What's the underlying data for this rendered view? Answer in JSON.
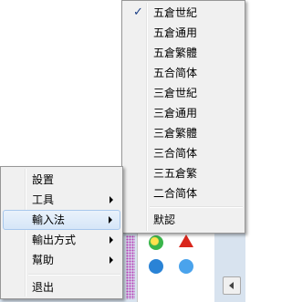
{
  "main_menu": {
    "items": [
      {
        "label": "設置",
        "has_submenu": false
      },
      {
        "label": "工具",
        "has_submenu": true
      },
      {
        "label": "輸入法",
        "has_submenu": true,
        "highlighted": true
      },
      {
        "label": "輸出方式",
        "has_submenu": true
      },
      {
        "label": "幫助",
        "has_submenu": true
      },
      {
        "label": "退出",
        "has_submenu": false
      }
    ]
  },
  "input_method_menu": {
    "items": [
      {
        "label": "五倉世紀",
        "checked": true
      },
      {
        "label": "五倉通用",
        "checked": false
      },
      {
        "label": "五倉繁體",
        "checked": false
      },
      {
        "label": "五合简体",
        "checked": false
      },
      {
        "label": "三倉世紀",
        "checked": false
      },
      {
        "label": "三倉通用",
        "checked": false
      },
      {
        "label": "三倉繁體",
        "checked": false
      },
      {
        "label": "三合简体",
        "checked": false
      },
      {
        "label": "三五倉繁",
        "checked": false
      },
      {
        "label": "二合简体",
        "checked": false
      },
      {
        "label": "默認",
        "checked": false
      }
    ],
    "check_glyph": "✓"
  },
  "tray": {
    "icons": [
      "green-yellow-app-icon",
      "red-arrow-icon",
      "blue-app-icon",
      "blue-star-icon"
    ],
    "scroll_icon": "scroll-left-icon"
  }
}
